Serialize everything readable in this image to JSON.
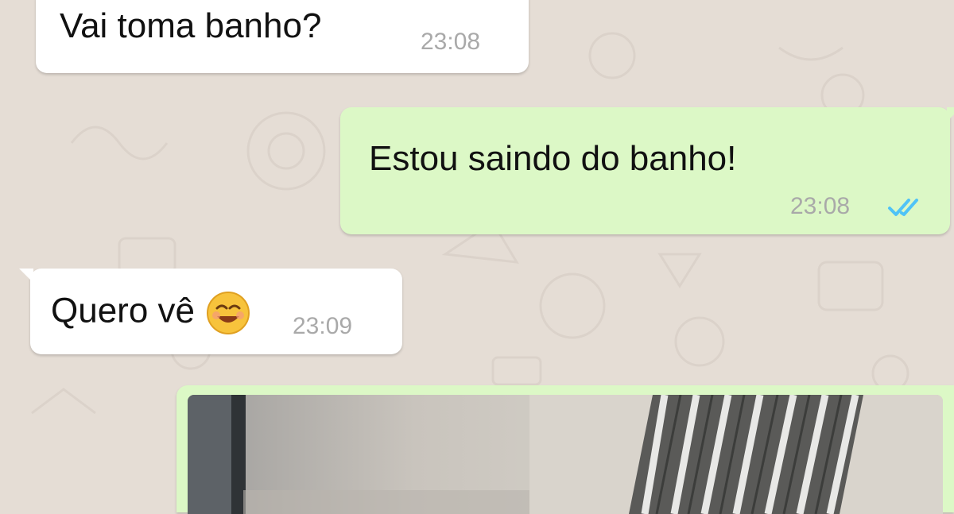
{
  "conversation": {
    "messages": [
      {
        "direction": "incoming",
        "text": "Vai toma banho?",
        "time": "23:08"
      },
      {
        "direction": "outgoing",
        "text": "Estou saindo do banho!",
        "time": "23:08",
        "status_icon": "double-check-icon",
        "status_color": "#4fc3f7"
      },
      {
        "direction": "incoming",
        "text": "Quero vê",
        "emoji": "smiling-face-icon",
        "time": "23:09"
      },
      {
        "direction": "outgoing",
        "type": "image",
        "content": "photo"
      }
    ]
  },
  "colors": {
    "background": "#e5ddd5",
    "incoming_bubble": "#ffffff",
    "outgoing_bubble": "#dcf8c6",
    "timestamp": "#a9a9a9",
    "read_ticks": "#4fc3f7"
  }
}
